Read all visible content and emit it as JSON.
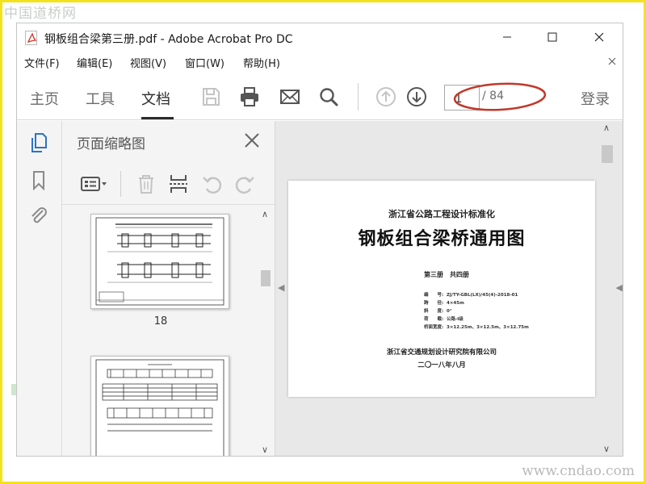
{
  "watermarks": {
    "top": "中国道桥网",
    "bottom": "www.cndao.com"
  },
  "window": {
    "title": "钢板组合梁第三册.pdf - Adobe Acrobat Pro DC",
    "icon": "pdf-file-icon",
    "controls": {
      "minimize": "minimize-icon",
      "maximize": "maximize-icon",
      "close": "close-icon"
    }
  },
  "menu": {
    "items": [
      "文件(F)",
      "编辑(E)",
      "视图(V)",
      "窗口(W)",
      "帮助(H)"
    ],
    "close": "close-icon"
  },
  "toolbar": {
    "tabs": [
      {
        "label": "主页",
        "active": false
      },
      {
        "label": "工具",
        "active": false
      },
      {
        "label": "文档",
        "active": true
      }
    ],
    "icons": [
      "save-icon",
      "print-icon",
      "email-icon",
      "search-icon",
      "page-up-icon",
      "page-down-icon"
    ],
    "page_input": "1",
    "page_total": "/ 84",
    "login": "登录",
    "annotation": "red-oval-highlight"
  },
  "left_rail": {
    "icons": [
      "page-thumbnails-icon",
      "bookmark-icon",
      "attachment-icon"
    ]
  },
  "thumbnail_panel": {
    "title": "页面缩略图",
    "close": "close-icon",
    "tools": [
      "options-menu-icon",
      "delete-page-icon",
      "insert-page-icon",
      "undo-icon",
      "redo-icon"
    ],
    "thumbnails": [
      {
        "label": "18"
      },
      {
        "label": ""
      }
    ]
  },
  "document": {
    "subtitle": "浙江省公路工程设计标准化",
    "title": "钢板组合梁桥通用图",
    "volume": "第三册　共四册",
    "info": [
      {
        "key": "编　　号:",
        "value": "ZJ/TY-GBL(LX)/45(4)-2018-01"
      },
      {
        "key": "跨　　径:",
        "value": "4×45m"
      },
      {
        "key": "斜　　度:",
        "value": "0°"
      },
      {
        "key": "荷　　载:",
        "value": "公路-Ⅰ级"
      },
      {
        "key": "桥面宽度:",
        "value": "3×12.25m、3×12.5m、3×12.75m"
      }
    ],
    "organization": "浙江省交通规划设计研究院有限公司",
    "date": "二〇一八年八月"
  },
  "colors": {
    "frame": "#f3e21c",
    "oval": "#c0392b",
    "accent": "#2b2b2b"
  }
}
